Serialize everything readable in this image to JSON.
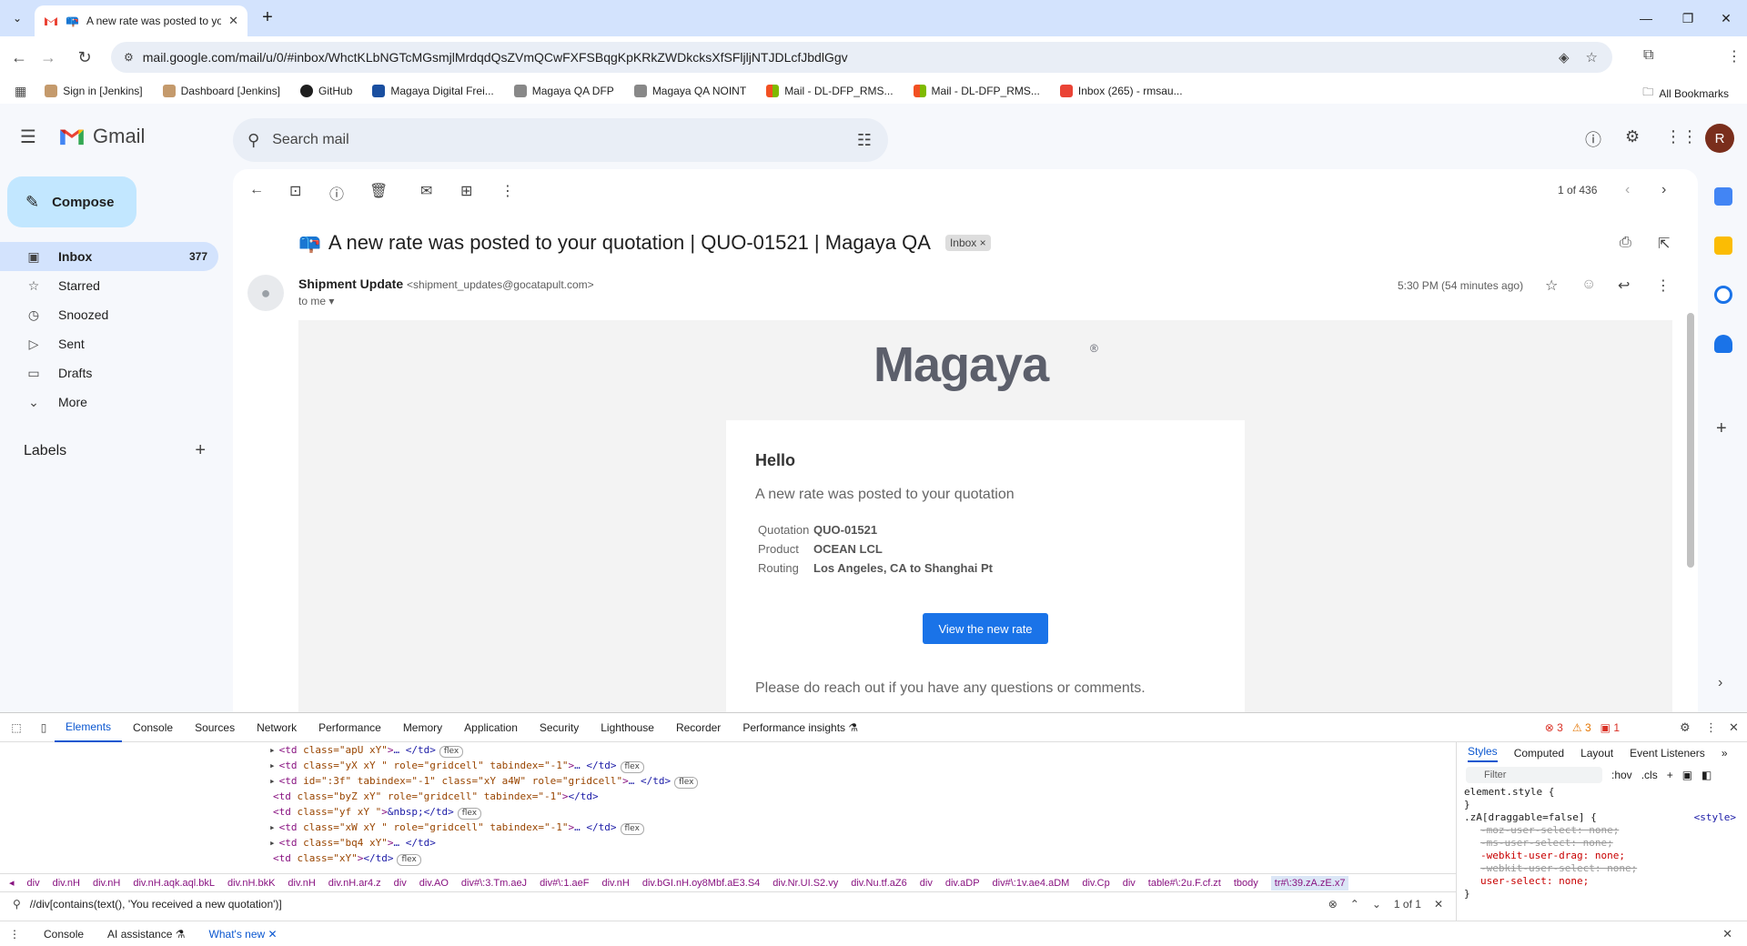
{
  "browser": {
    "tab_title": "A new rate was posted to yo",
    "url": "mail.google.com/mail/u/0/#inbox/WhctKLbNGTcMGsmjlMrdqdQsZVmQCwFXFSBqgKpKRkZWDkcksXfSFljljNTJDLcfJbdlGgv",
    "bookmarks": [
      "Sign in [Jenkins]",
      "Dashboard [Jenkins]",
      "GitHub",
      "Magaya Digital Frei...",
      "Magaya QA DFP",
      "Magaya QA NOINT",
      "Mail - DL-DFP_RMS...",
      "Mail - DL-DFP_RMS...",
      "Inbox (265) - rmsau..."
    ],
    "all_bookmarks": "All Bookmarks"
  },
  "gmail": {
    "logo_text": "Gmail",
    "search_placeholder": "Search mail",
    "avatar_letter": "R",
    "compose_label": "Compose",
    "nav": [
      {
        "label": "Inbox",
        "count": "377",
        "icon": "inbox-icon"
      },
      {
        "label": "Starred",
        "count": "",
        "icon": "star-icon"
      },
      {
        "label": "Snoozed",
        "count": "",
        "icon": "clock-icon"
      },
      {
        "label": "Sent",
        "count": "",
        "icon": "send-icon"
      },
      {
        "label": "Drafts",
        "count": "",
        "icon": "draft-icon"
      },
      {
        "label": "More",
        "count": "",
        "icon": "chevron-down-icon"
      }
    ],
    "labels_heading": "Labels",
    "pager": "1 of 436",
    "subject": "A new rate was posted to your quotation | QUO-01521 | Magaya QA",
    "subject_badge": "Inbox",
    "sender_name": "Shipment Update",
    "sender_email": "<shipment_updates@gocatapult.com>",
    "to_me": "to me",
    "time": "5:30 PM (54 minutes ago)",
    "email_body": {
      "brand": "Magaya",
      "greeting": "Hello",
      "lead": "A new rate was posted to your quotation",
      "fields": [
        {
          "label": "Quotation",
          "value": "QUO-01521"
        },
        {
          "label": "Product",
          "value": "OCEAN LCL"
        },
        {
          "label": "Routing",
          "value": "Los Angeles, CA to Shanghai Pt"
        }
      ],
      "cta": "View the new rate",
      "outro": "Please do reach out if you have any questions or comments."
    }
  },
  "devtools": {
    "tabs": [
      "Elements",
      "Console",
      "Sources",
      "Network",
      "Performance",
      "Memory",
      "Application",
      "Security",
      "Lighthouse",
      "Recorder",
      "Performance insights"
    ],
    "errors": "3",
    "warnings": "3",
    "issues": "1",
    "dom_lines": [
      {
        "tri": "▸",
        "tag": "td",
        "attrs": "class=\"apU xY\"",
        "tail": "… </td>",
        "flex": "flex"
      },
      {
        "tri": "▸",
        "tag": "td",
        "attrs": "class=\"yX xY \" role=\"gridcell\" tabindex=\"-1\"",
        "tail": "… </td>",
        "flex": "flex"
      },
      {
        "tri": "▸",
        "tag": "td",
        "attrs": "id=\":3f\" tabindex=\"-1\" class=\"xY a4W\" role=\"gridcell\"",
        "tail": "… </td>",
        "flex": "flex"
      },
      {
        "tri": "",
        "tag": "td",
        "attrs": "class=\"byZ xY\" role=\"gridcell\" tabindex=\"-1\"",
        "tail": "</td>",
        "flex": ""
      },
      {
        "tri": "",
        "tag": "td",
        "attrs": "class=\"yf xY \"",
        "tail": "&nbsp;</td>",
        "flex": "flex"
      },
      {
        "tri": "▸",
        "tag": "td",
        "attrs": "class=\"xW xY \" role=\"gridcell\" tabindex=\"-1\"",
        "tail": "… </td>",
        "flex": "flex"
      },
      {
        "tri": "▸",
        "tag": "td",
        "attrs": "class=\"bq4 xY\"",
        "tail": "… </td>",
        "flex": ""
      },
      {
        "tri": "",
        "tag": "td",
        "attrs": "class=\"xY\"",
        "tail": "</td>",
        "flex": "flex"
      }
    ],
    "breadcrumbs": [
      "div",
      "div.nH",
      "div.nH",
      "div.nH.aqk.aql.bkL",
      "div.nH.bkK",
      "div.nH",
      "div.nH.ar4.z",
      "div",
      "div.AO",
      "div#\\:3.Tm.aeJ",
      "div#\\:1.aeF",
      "div.nH",
      "div.bGI.nH.oy8Mbf.aE3.S4",
      "div.Nr.UI.S2.vy",
      "div.Nu.tf.aZ6",
      "div",
      "div.aDP",
      "div#\\:1v.ae4.aDM",
      "div.Cp",
      "div",
      "table#\\:2u.F.cf.zt",
      "tbody",
      "tr#\\:39.zA.zE.x7"
    ],
    "find_query": "//div[contains(text(), 'You received a new quotation')]",
    "find_count": "1 of 1",
    "drawer": [
      "Console",
      "AI assistance",
      "What's new"
    ],
    "styles_tabs": [
      "Styles",
      "Computed",
      "Layout",
      "Event Listeners"
    ],
    "filter_placeholder": "Filter",
    "filter_hov": ":hov",
    "filter_cls": ".cls",
    "css_rules": [
      {
        "selector": "element.style {",
        "props": [],
        "close": "}",
        "source": ""
      },
      {
        "selector": ".zA[draggable=false] {",
        "props": [
          {
            "text": "-moz-user-select: none;",
            "strike": true
          },
          {
            "text": "-ms-user-select: none;",
            "strike": true
          },
          {
            "text": "-webkit-user-drag: none;",
            "strike": false
          },
          {
            "text": "-webkit-user-select: none;",
            "strike": true
          },
          {
            "text": "user-select: none;",
            "strike": false
          }
        ],
        "close": "}",
        "source": "<style>"
      }
    ]
  }
}
